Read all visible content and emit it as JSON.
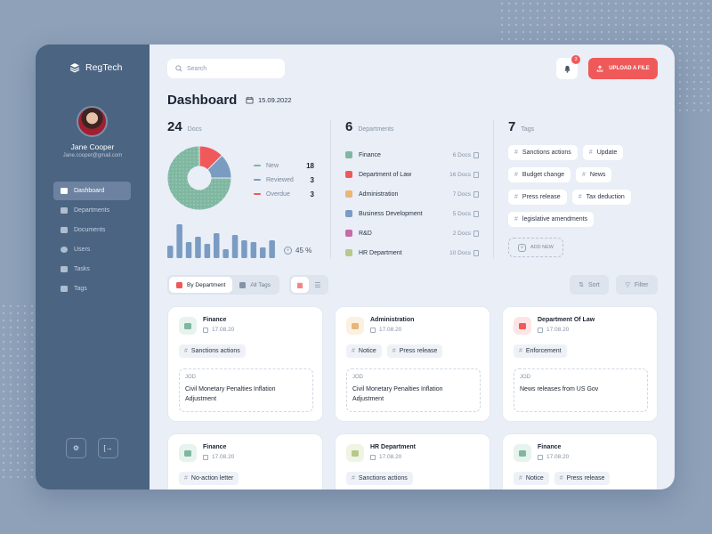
{
  "app": {
    "name": "RegTech"
  },
  "user": {
    "name": "Jane Cooper",
    "email": "Jane.cooper@gmail.com"
  },
  "nav": [
    {
      "label": "Dashboard",
      "active": true
    },
    {
      "label": "Departments"
    },
    {
      "label": "Documents"
    },
    {
      "label": "Users"
    },
    {
      "label": "Tasks"
    },
    {
      "label": "Tags"
    }
  ],
  "search": {
    "placeholder": "Search"
  },
  "notifications": {
    "count": "3"
  },
  "upload": {
    "label": "UPLOAD A FILE"
  },
  "page": {
    "title": "Dashboard",
    "date": "15.09.2022"
  },
  "docs": {
    "count": "24",
    "label": "Docs",
    "legend": [
      {
        "label": "New",
        "value": "18",
        "color": "#7fb7a1"
      },
      {
        "label": "Reviewed",
        "value": "3",
        "color": "#7a9cc2"
      },
      {
        "label": "Overdue",
        "value": "3",
        "color": "#f05959"
      }
    ],
    "percent": "45 %"
  },
  "departments": {
    "count": "6",
    "label": "Departments",
    "items": [
      {
        "name": "Finance",
        "docs": "6 Docs",
        "color": "#7fb7a1"
      },
      {
        "name": "Department of Law",
        "docs": "16 Docs",
        "color": "#f05959"
      },
      {
        "name": "Administration",
        "docs": "7 Docs",
        "color": "#e6b777"
      },
      {
        "name": "Business Development",
        "docs": "5 Docs",
        "color": "#7a9cc2"
      },
      {
        "name": "R&D",
        "docs": "2 Docs",
        "color": "#c86aa9"
      },
      {
        "name": "HR Department",
        "docs": "10 Docs",
        "color": "#b7c98a"
      }
    ]
  },
  "tags": {
    "count": "7",
    "label": "Tags",
    "items": [
      "Sanctions actions",
      "Update",
      "Budget change",
      "News",
      "Press release",
      "Tax deduction",
      "legislative amendments"
    ],
    "add_label": "ADD NEW"
  },
  "filters": {
    "by_department": "By Department",
    "all_tags": "All Tags",
    "sort": "Sort",
    "filter": "Filter"
  },
  "cards": [
    {
      "dept": "Finance",
      "date": "17.08.20",
      "tags": [
        "Sanctions actions"
      ],
      "box_label": "JOD",
      "box_text": "Civil Monetary Penalties Inflation Adjustment",
      "color": "#7fb7a1",
      "bg": "#e7f3ee"
    },
    {
      "dept": "Administration",
      "date": "17.08.20",
      "tags": [
        "Notice",
        "Press release"
      ],
      "box_label": "JOD",
      "box_text": "Civil Monetary Penalties Inflation Adjustment",
      "color": "#e6b777",
      "bg": "#fbf0e1"
    },
    {
      "dept": "Department Of Law",
      "date": "17.08.20",
      "tags": [
        "Enforcement"
      ],
      "box_label": "JOD",
      "box_text": "News releases from US Gov",
      "color": "#f05959",
      "bg": "#fde5e5"
    },
    {
      "dept": "Finance",
      "date": "17.08.20",
      "tags": [
        "No-action letter"
      ],
      "color": "#7fb7a1",
      "bg": "#e7f3ee"
    },
    {
      "dept": "HR Department",
      "date": "17.08.20",
      "tags": [
        "Sanctions actions"
      ],
      "color": "#b7c98a",
      "bg": "#eff4e4"
    },
    {
      "dept": "Finance",
      "date": "17.08.20",
      "tags": [
        "Notice",
        "Press release"
      ],
      "color": "#7fb7a1",
      "bg": "#e7f3ee"
    }
  ],
  "chart_data": {
    "type": "pie",
    "categories": [
      "New",
      "Reviewed",
      "Overdue"
    ],
    "values": [
      18,
      3,
      3
    ],
    "bars": [
      14,
      38,
      18,
      24,
      16,
      28,
      10,
      26,
      20,
      18,
      12,
      20
    ]
  }
}
